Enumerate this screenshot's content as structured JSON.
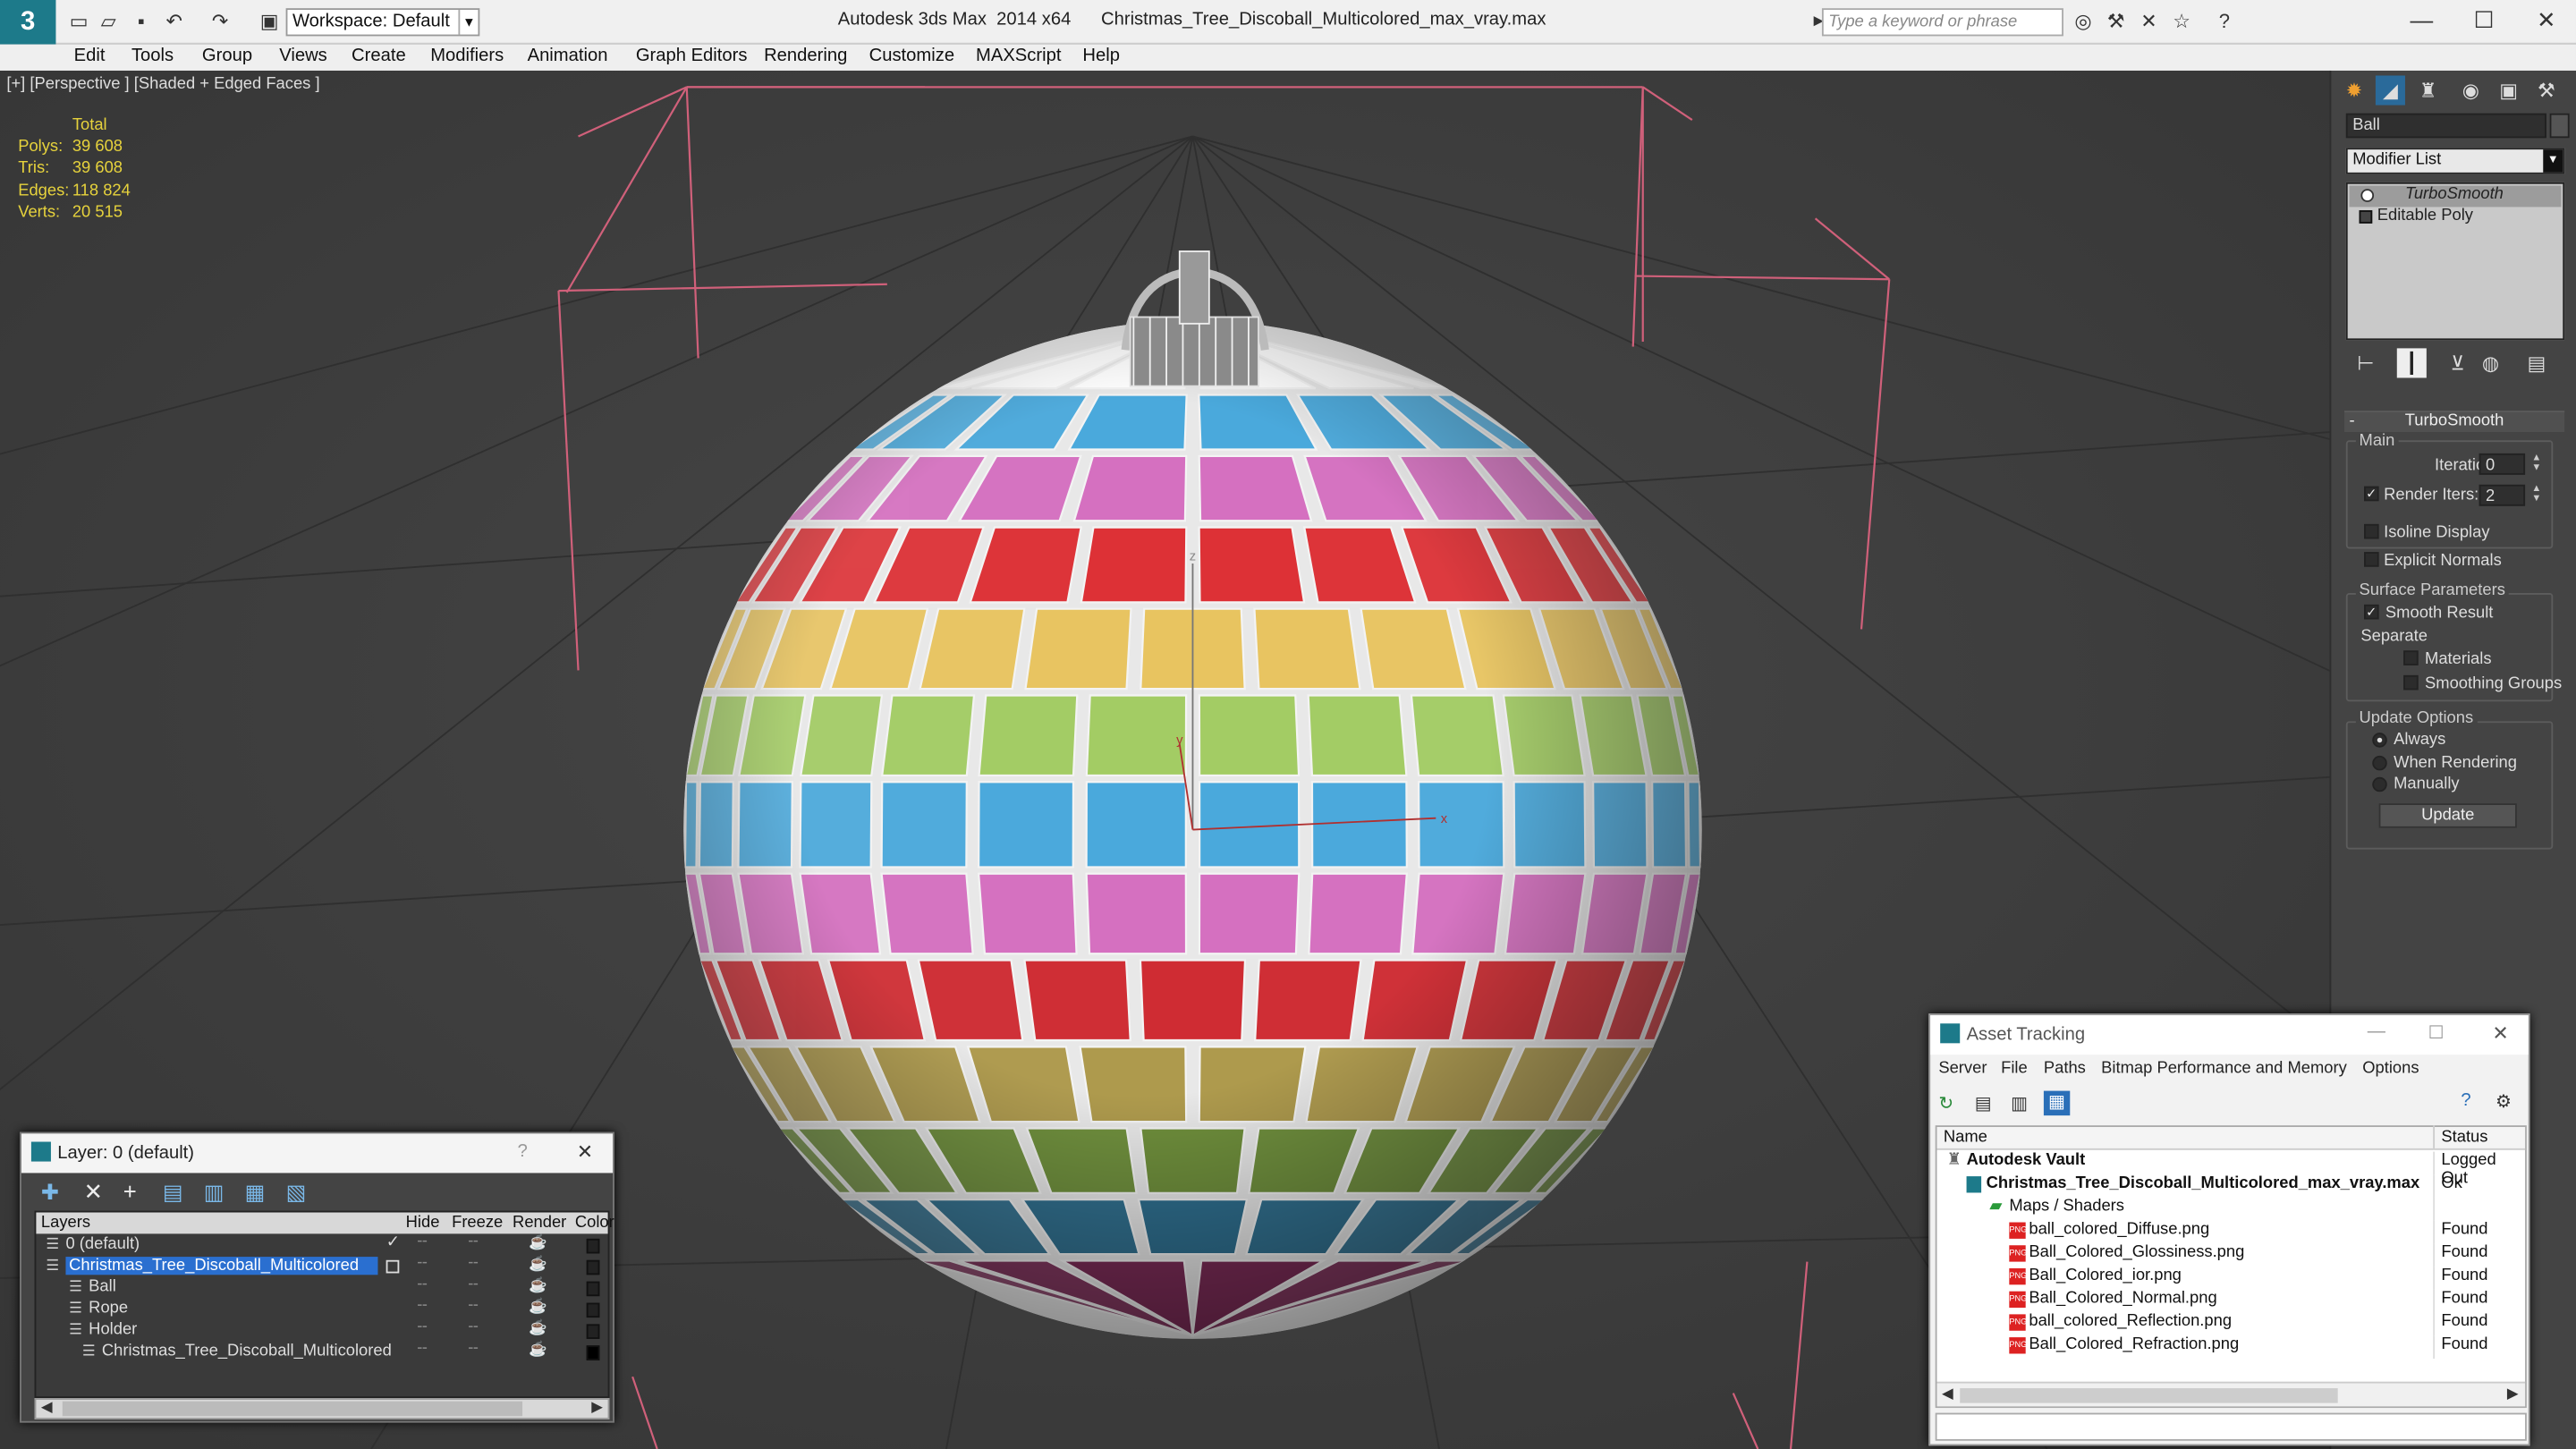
{
  "titlebar": {
    "app": "Autodesk 3ds Max  2014 x64",
    "file": "Christmas_Tree_Discoball_Multicolored_max_vray.max",
    "workspace": "Workspace: Default",
    "search_placeholder": "Type a keyword or phrase"
  },
  "menu": [
    "Edit",
    "Tools",
    "Group",
    "Views",
    "Create",
    "Modifiers",
    "Animation",
    "Graph Editors",
    "Rendering",
    "Customize",
    "MAXScript",
    "Help"
  ],
  "viewport": {
    "label": "[+] [Perspective ] [Shaded + Edged Faces ]",
    "stats": {
      "header": "Total",
      "rows": [
        {
          "k": "Polys:",
          "v": "39 608"
        },
        {
          "k": "Tris:",
          "v": "39 608"
        },
        {
          "k": "Edges:",
          "v": "118 824"
        },
        {
          "k": "Verts:",
          "v": "20 515"
        }
      ]
    },
    "axis": {
      "x": "x",
      "y": "y",
      "z": "z"
    }
  },
  "cmd": {
    "object_name": "Ball",
    "modifier_list": "Modifier List",
    "stack": [
      "TurboSmooth",
      "Editable Poly"
    ],
    "rollout": "TurboSmooth",
    "main": "Main",
    "iterations_label": "Iterations:",
    "iterations": "0",
    "render_iters_label": "Render Iters:",
    "render_iters": "2",
    "isoline": "Isoline Display",
    "explicit": "Explicit Normals",
    "surface": "Surface Parameters",
    "smooth": "Smooth Result",
    "separate": "Separate",
    "materials": "Materials",
    "smoothing": "Smoothing Groups",
    "update_options": "Update Options",
    "always": "Always",
    "when_rendering": "When Rendering",
    "manually": "Manually",
    "update": "Update"
  },
  "layers": {
    "title": "Layer: 0 (default)",
    "cols": {
      "layers": "Layers",
      "hide": "Hide",
      "freeze": "Freeze",
      "render": "Render",
      "color": "Color"
    },
    "rows": [
      {
        "name": "0 (default)"
      },
      {
        "name": "Christmas_Tree_Discoball_Multicolored"
      },
      {
        "name": "Ball"
      },
      {
        "name": "Rope"
      },
      {
        "name": "Holder"
      },
      {
        "name": "Christmas_Tree_Discoball_Multicolored"
      }
    ]
  },
  "assets": {
    "title": "Asset Tracking",
    "menu": [
      "Server",
      "File",
      "Paths",
      "Bitmap Performance and Memory",
      "Options"
    ],
    "cols": {
      "name": "Name",
      "status": "Status"
    },
    "rows": [
      {
        "name": "Autodesk Vault",
        "status": "Logged Out"
      },
      {
        "name": "Christmas_Tree_Discoball_Multicolored_max_vray.max",
        "status": "Ok"
      },
      {
        "name": "Maps / Shaders",
        "status": ""
      },
      {
        "name": "ball_colored_Diffuse.png",
        "status": "Found"
      },
      {
        "name": "Ball_Colored_Glossiness.png",
        "status": "Found"
      },
      {
        "name": "Ball_Colored_ior.png",
        "status": "Found"
      },
      {
        "name": "Ball_Colored_Normal.png",
        "status": "Found"
      },
      {
        "name": "ball_colored_Reflection.png",
        "status": "Found"
      },
      {
        "name": "Ball_Colored_Refraction.png",
        "status": "Found"
      }
    ]
  },
  "colors": {
    "bands": [
      "#ffffff",
      "#4aa9dc",
      "#d570c0",
      "#dd3136",
      "#e8c460",
      "#a3cc64",
      "#4aa9dc",
      "#d570c0",
      "#cf2c33",
      "#ae9a4d",
      "#6f8f3c",
      "#2f6f8f",
      "#7a2a55"
    ],
    "stats": "#e6d23c",
    "gizmo": "#d0607a"
  }
}
